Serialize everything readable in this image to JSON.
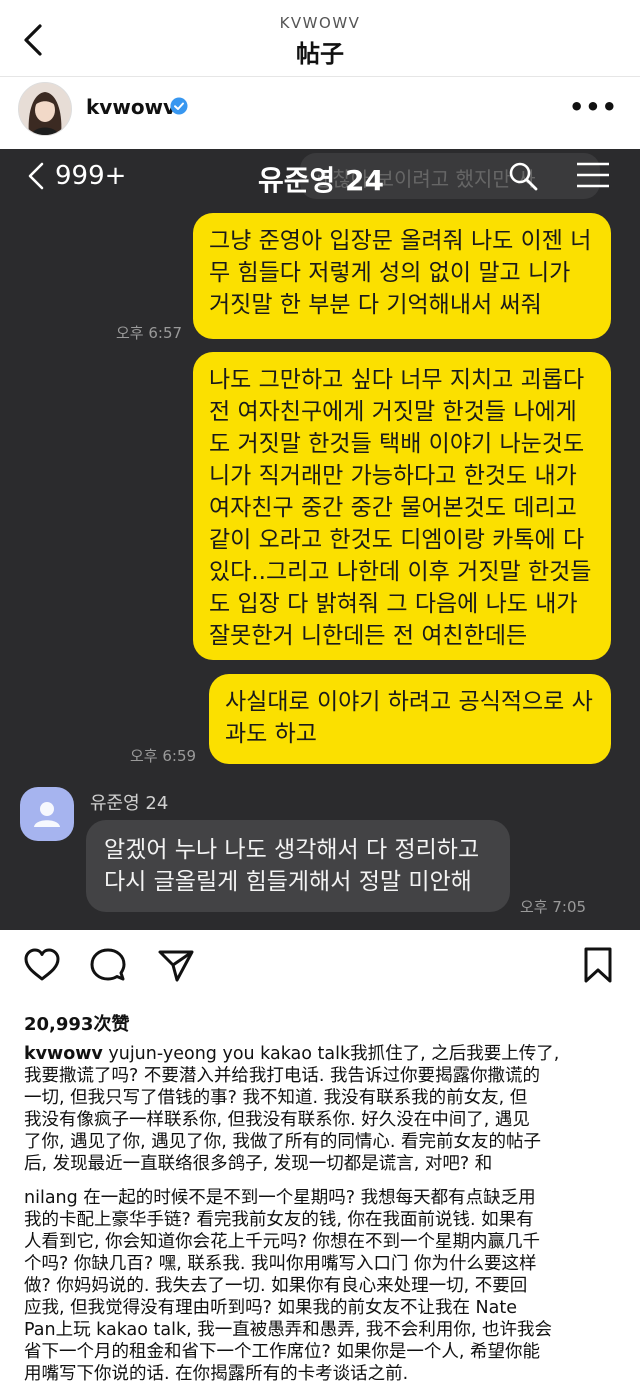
{
  "header": {
    "username": "KVWOWV",
    "title": "帖子"
  },
  "post": {
    "username": "kvwowv"
  },
  "chat": {
    "unread_count": "999+",
    "title": "유준영 24",
    "ghost_text": "괜찮아 보이려고 했지만 사",
    "messages_out": [
      {
        "lines": [
          "그냥 준영아 입장문 올려줘 나도 이젠 너",
          "무 힘들다 저렇게 성의 없이 말고 니가",
          "거짓말 한 부분 다 기억해내서 써줘"
        ],
        "time": "오후 6:57"
      },
      {
        "lines": [
          "나도 그만하고 싶다 너무 지치고 괴롭다",
          "전 여자친구에게 거짓말 한것들 나에게",
          "도 거짓말 한것들 택배 이야기 나눈것도",
          "니가 직거래만 가능하다고 한것도 내가",
          "여자친구 중간 중간 물어본것도 데리고",
          "같이 오라고 한것도 디엠이랑 카톡에 다",
          "있다..그리고 나한데 이후 거짓말 한것들",
          "도 입장 다 밝혀줘 그 다음에 나도 내가",
          "잘못한거 니한데든 전 여친한데든"
        ]
      },
      {
        "lines": [
          "사실대로 이야기 하려고 공식적으로 사",
          "과도 하고"
        ],
        "time": "오후 6:59"
      }
    ],
    "friend_name": "유준영 24",
    "message_in": {
      "lines": [
        "알겠어 누나 나도 생각해서 다 정리하고",
        "다시 글올릴게 힘들게해서 정말 미안해"
      ],
      "time": "오후 7:05"
    }
  },
  "likes": "20,993次赞",
  "caption": {
    "username": "kvwowv",
    "first_line_rest": " yujun-yeong you kakao talk我抓住了, 之后我要上传了,",
    "para1": [
      "我要撒谎了吗? 不要潜入并给我打电话. 我告诉过你要揭露你撒谎的",
      "一切, 但我只写了借钱的事? 我不知道. 我没有联系我的前女友, 但",
      "我没有像疯子一样联系你, 但我没有联系你. 好久没在中间了, 遇见",
      "了你, 遇见了你, 遇见了你, 我做了所有的同情心. 看完前女友的帖子",
      "后, 发现最近一直联络很多鸽子, 发现一切都是谎言, 对吧? 和"
    ],
    "para2": [
      "nilang 在一起的时候不是不到一个星期吗? 我想每天都有点缺乏用",
      "我的卡配上豪华手链? 看完我前女友的钱, 你在我面前说钱. 如果有",
      "人看到它, 你会知道你会花上千元吗? 你想在不到一个星期内赢几千",
      "个吗? 你缺几百? 嘿, 联系我. 我叫你用嘴写入口门 你为什么要这样",
      "做? 你妈妈说的. 我失去了一切. 如果你有良心来处理一切, 不要回",
      "应我, 但我觉得没有理由听到吗? 如果我的前女友不让我在 Nate",
      "Pan上玩 kakao talk, 我一直被愚弄和愚弄, 我不会利用你, 也许我会",
      "省下一个月的租金和省下一个工作席位? 如果你是一个人, 希望你能",
      "用嘴写下你说的话. 在你揭露所有的卡考谈话之前."
    ]
  },
  "colors": {
    "kakao_yellow": "#fbe000",
    "chat_bg": "#2b2b2d",
    "verified_blue": "#3897f0"
  }
}
